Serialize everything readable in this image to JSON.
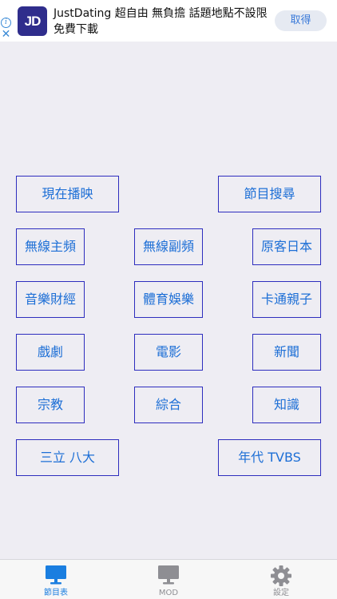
{
  "ad": {
    "logo_text": "JD",
    "headline": "JustDating 超自由 無負擔 話題地點不設限 免費下載",
    "button_label": "取得",
    "info_glyph": "i",
    "close_glyph": "✕"
  },
  "channels": {
    "now_playing": "現在播映",
    "program_search": "節目搜尋",
    "wireless_main": "無線主頻",
    "wireless_sub": "無線副頻",
    "hakka_japan": "原客日本",
    "music_finance": "音樂財經",
    "sports_ent": "體育娛樂",
    "cartoon_family": "卡通親子",
    "drama": "戲劇",
    "movies": "電影",
    "news": "新聞",
    "religion": "宗教",
    "variety": "綜合",
    "knowledge": "知識",
    "sanli_bada": "三立 八大",
    "era_tvbs": "年代 TVBS"
  },
  "tabbar": {
    "tabs": [
      {
        "label": "節目表",
        "icon": "monitor-icon",
        "active": true
      },
      {
        "label": "MOD",
        "icon": "monitor-icon",
        "active": false
      },
      {
        "label": "設定",
        "icon": "gear-icon",
        "active": false
      }
    ],
    "active_color": "#1a7ee0",
    "inactive_color": "#8e8e93"
  }
}
